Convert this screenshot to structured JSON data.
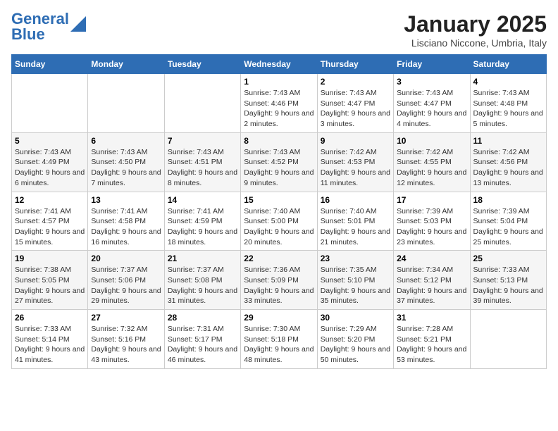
{
  "header": {
    "logo_line1": "General",
    "logo_line2": "Blue",
    "month": "January 2025",
    "location": "Lisciano Niccone, Umbria, Italy"
  },
  "days_of_week": [
    "Sunday",
    "Monday",
    "Tuesday",
    "Wednesday",
    "Thursday",
    "Friday",
    "Saturday"
  ],
  "weeks": [
    [
      {
        "day": "",
        "info": ""
      },
      {
        "day": "",
        "info": ""
      },
      {
        "day": "",
        "info": ""
      },
      {
        "day": "1",
        "sunrise": "Sunrise: 7:43 AM",
        "sunset": "Sunset: 4:46 PM",
        "daylight": "Daylight: 9 hours and 2 minutes."
      },
      {
        "day": "2",
        "sunrise": "Sunrise: 7:43 AM",
        "sunset": "Sunset: 4:47 PM",
        "daylight": "Daylight: 9 hours and 3 minutes."
      },
      {
        "day": "3",
        "sunrise": "Sunrise: 7:43 AM",
        "sunset": "Sunset: 4:47 PM",
        "daylight": "Daylight: 9 hours and 4 minutes."
      },
      {
        "day": "4",
        "sunrise": "Sunrise: 7:43 AM",
        "sunset": "Sunset: 4:48 PM",
        "daylight": "Daylight: 9 hours and 5 minutes."
      }
    ],
    [
      {
        "day": "5",
        "sunrise": "Sunrise: 7:43 AM",
        "sunset": "Sunset: 4:49 PM",
        "daylight": "Daylight: 9 hours and 6 minutes."
      },
      {
        "day": "6",
        "sunrise": "Sunrise: 7:43 AM",
        "sunset": "Sunset: 4:50 PM",
        "daylight": "Daylight: 9 hours and 7 minutes."
      },
      {
        "day": "7",
        "sunrise": "Sunrise: 7:43 AM",
        "sunset": "Sunset: 4:51 PM",
        "daylight": "Daylight: 9 hours and 8 minutes."
      },
      {
        "day": "8",
        "sunrise": "Sunrise: 7:43 AM",
        "sunset": "Sunset: 4:52 PM",
        "daylight": "Daylight: 9 hours and 9 minutes."
      },
      {
        "day": "9",
        "sunrise": "Sunrise: 7:42 AM",
        "sunset": "Sunset: 4:53 PM",
        "daylight": "Daylight: 9 hours and 11 minutes."
      },
      {
        "day": "10",
        "sunrise": "Sunrise: 7:42 AM",
        "sunset": "Sunset: 4:55 PM",
        "daylight": "Daylight: 9 hours and 12 minutes."
      },
      {
        "day": "11",
        "sunrise": "Sunrise: 7:42 AM",
        "sunset": "Sunset: 4:56 PM",
        "daylight": "Daylight: 9 hours and 13 minutes."
      }
    ],
    [
      {
        "day": "12",
        "sunrise": "Sunrise: 7:41 AM",
        "sunset": "Sunset: 4:57 PM",
        "daylight": "Daylight: 9 hours and 15 minutes."
      },
      {
        "day": "13",
        "sunrise": "Sunrise: 7:41 AM",
        "sunset": "Sunset: 4:58 PM",
        "daylight": "Daylight: 9 hours and 16 minutes."
      },
      {
        "day": "14",
        "sunrise": "Sunrise: 7:41 AM",
        "sunset": "Sunset: 4:59 PM",
        "daylight": "Daylight: 9 hours and 18 minutes."
      },
      {
        "day": "15",
        "sunrise": "Sunrise: 7:40 AM",
        "sunset": "Sunset: 5:00 PM",
        "daylight": "Daylight: 9 hours and 20 minutes."
      },
      {
        "day": "16",
        "sunrise": "Sunrise: 7:40 AM",
        "sunset": "Sunset: 5:01 PM",
        "daylight": "Daylight: 9 hours and 21 minutes."
      },
      {
        "day": "17",
        "sunrise": "Sunrise: 7:39 AM",
        "sunset": "Sunset: 5:03 PM",
        "daylight": "Daylight: 9 hours and 23 minutes."
      },
      {
        "day": "18",
        "sunrise": "Sunrise: 7:39 AM",
        "sunset": "Sunset: 5:04 PM",
        "daylight": "Daylight: 9 hours and 25 minutes."
      }
    ],
    [
      {
        "day": "19",
        "sunrise": "Sunrise: 7:38 AM",
        "sunset": "Sunset: 5:05 PM",
        "daylight": "Daylight: 9 hours and 27 minutes."
      },
      {
        "day": "20",
        "sunrise": "Sunrise: 7:37 AM",
        "sunset": "Sunset: 5:06 PM",
        "daylight": "Daylight: 9 hours and 29 minutes."
      },
      {
        "day": "21",
        "sunrise": "Sunrise: 7:37 AM",
        "sunset": "Sunset: 5:08 PM",
        "daylight": "Daylight: 9 hours and 31 minutes."
      },
      {
        "day": "22",
        "sunrise": "Sunrise: 7:36 AM",
        "sunset": "Sunset: 5:09 PM",
        "daylight": "Daylight: 9 hours and 33 minutes."
      },
      {
        "day": "23",
        "sunrise": "Sunrise: 7:35 AM",
        "sunset": "Sunset: 5:10 PM",
        "daylight": "Daylight: 9 hours and 35 minutes."
      },
      {
        "day": "24",
        "sunrise": "Sunrise: 7:34 AM",
        "sunset": "Sunset: 5:12 PM",
        "daylight": "Daylight: 9 hours and 37 minutes."
      },
      {
        "day": "25",
        "sunrise": "Sunrise: 7:33 AM",
        "sunset": "Sunset: 5:13 PM",
        "daylight": "Daylight: 9 hours and 39 minutes."
      }
    ],
    [
      {
        "day": "26",
        "sunrise": "Sunrise: 7:33 AM",
        "sunset": "Sunset: 5:14 PM",
        "daylight": "Daylight: 9 hours and 41 minutes."
      },
      {
        "day": "27",
        "sunrise": "Sunrise: 7:32 AM",
        "sunset": "Sunset: 5:16 PM",
        "daylight": "Daylight: 9 hours and 43 minutes."
      },
      {
        "day": "28",
        "sunrise": "Sunrise: 7:31 AM",
        "sunset": "Sunset: 5:17 PM",
        "daylight": "Daylight: 9 hours and 46 minutes."
      },
      {
        "day": "29",
        "sunrise": "Sunrise: 7:30 AM",
        "sunset": "Sunset: 5:18 PM",
        "daylight": "Daylight: 9 hours and 48 minutes."
      },
      {
        "day": "30",
        "sunrise": "Sunrise: 7:29 AM",
        "sunset": "Sunset: 5:20 PM",
        "daylight": "Daylight: 9 hours and 50 minutes."
      },
      {
        "day": "31",
        "sunrise": "Sunrise: 7:28 AM",
        "sunset": "Sunset: 5:21 PM",
        "daylight": "Daylight: 9 hours and 53 minutes."
      },
      {
        "day": "",
        "info": ""
      }
    ]
  ]
}
